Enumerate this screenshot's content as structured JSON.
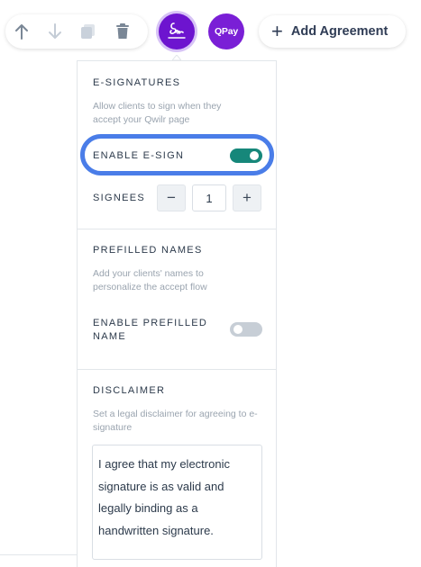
{
  "toolbar": {
    "move_up_icon": "arrow-up-icon",
    "move_down_icon": "arrow-down-icon",
    "duplicate_icon": "copy-icon",
    "delete_icon": "trash-icon",
    "esign_icon": "signature-icon",
    "qpay_label": "QPay",
    "add_agreement_label": "Add Agreement"
  },
  "esignatures": {
    "heading": "E-SIGNATURES",
    "description": "Allow clients to sign when they accept your Qwilr page",
    "enable_label": "ENABLE E-SIGN",
    "enable_on": true,
    "signees_label": "SIGNEES",
    "signees_value": "1",
    "minus_label": "−",
    "plus_label": "+"
  },
  "prefilled": {
    "heading": "PREFILLED NAMES",
    "description": "Add your clients' names to personalize the accept flow",
    "enable_label": "ENABLE PREFILLED NAME",
    "enable_on": false
  },
  "disclaimer": {
    "heading": "DISCLAIMER",
    "description": "Set a legal disclaimer for agreeing to e-signature",
    "text": "I agree that my electronic signature is as valid and legally binding as a handwritten signature."
  },
  "colors": {
    "accent_purple": "#6d14cf",
    "toggle_on": "#16877a",
    "highlight_blue": "#4a7de8"
  }
}
